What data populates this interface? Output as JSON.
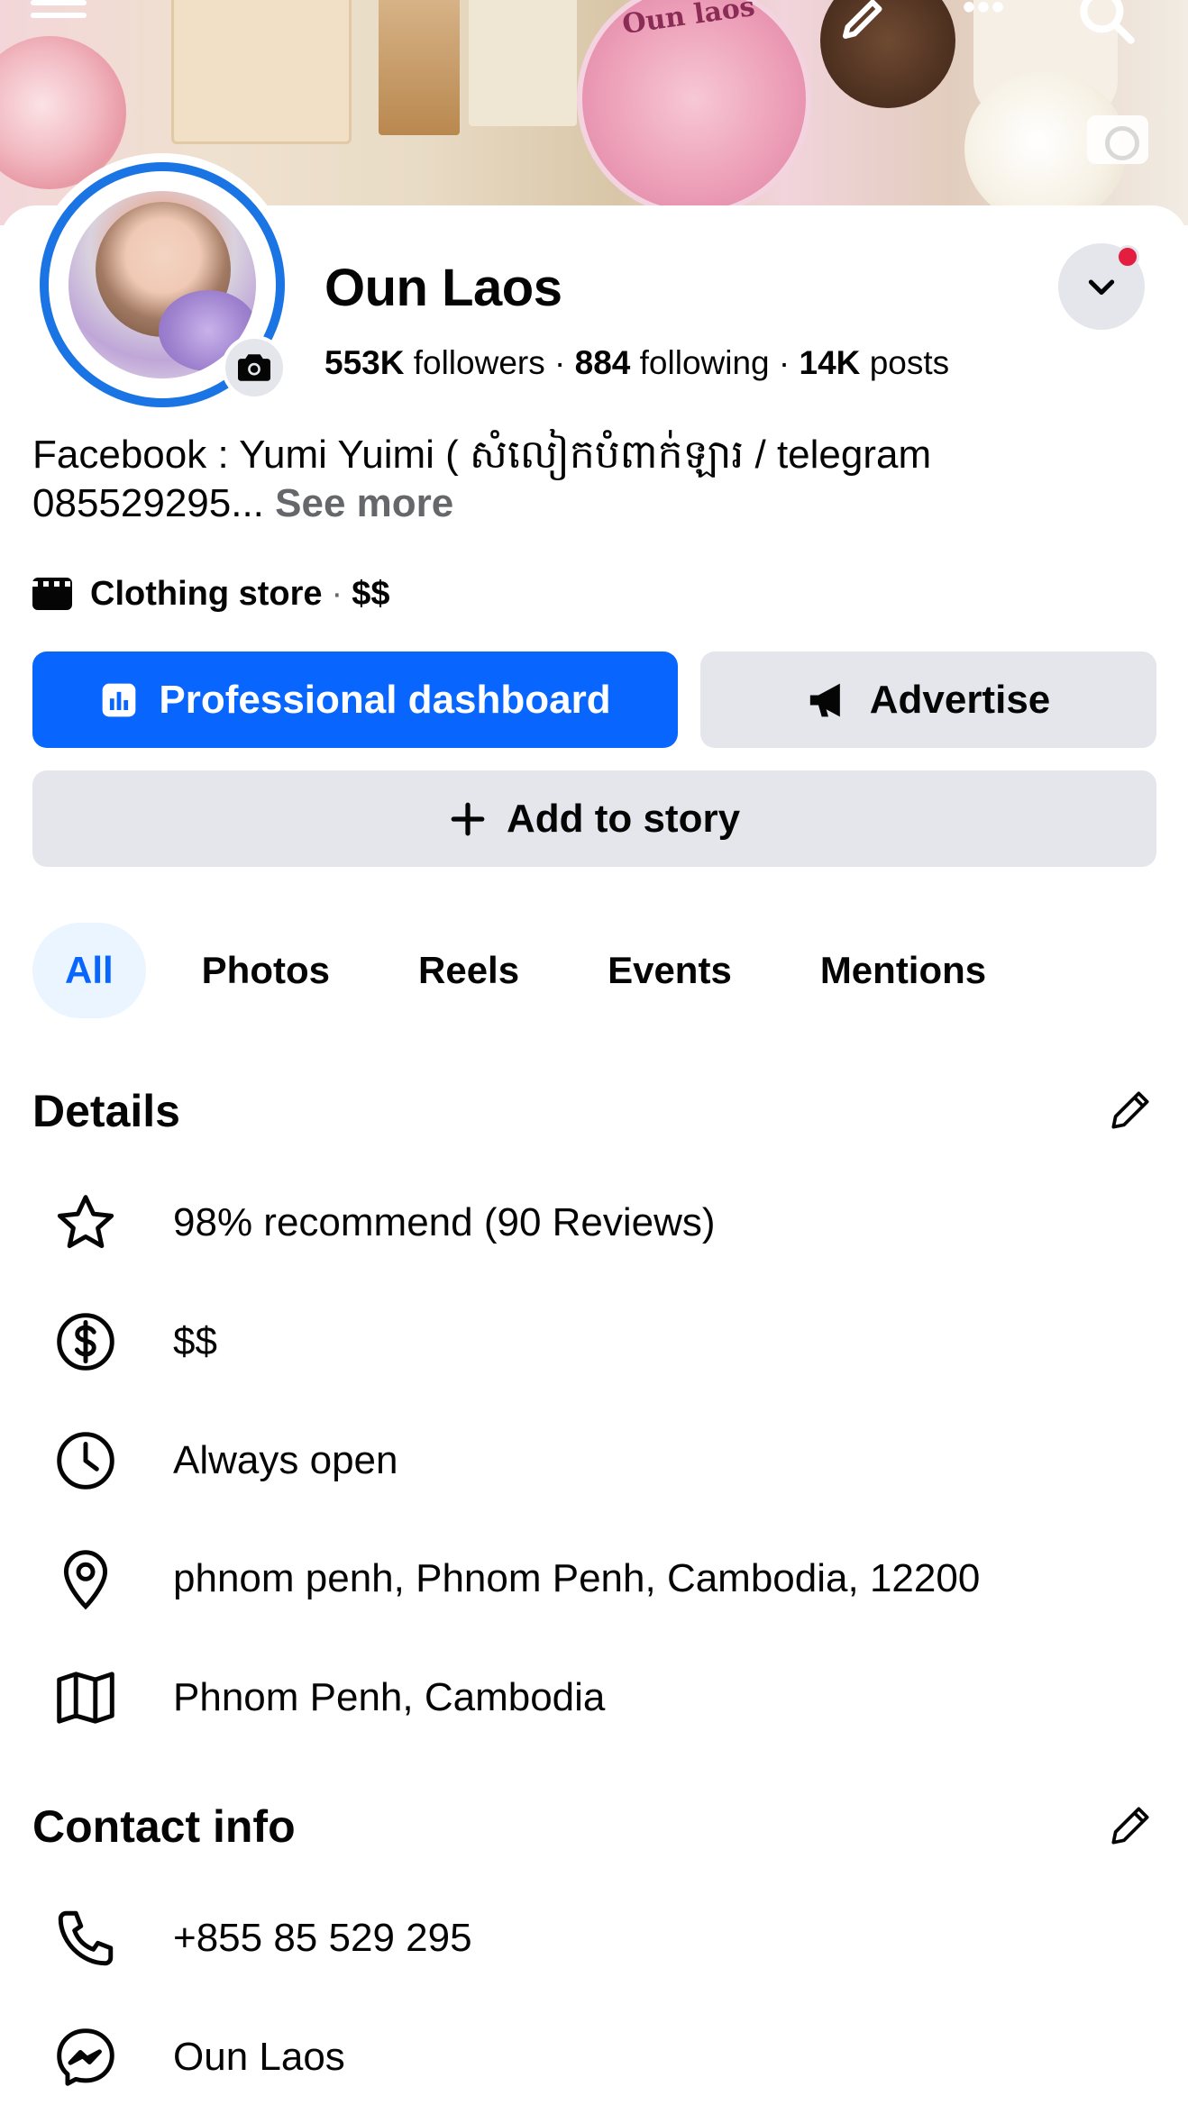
{
  "cover": {
    "jar_text": "Oun laos"
  },
  "profile": {
    "name": "Oun Laos",
    "followers_count": "553K",
    "followers_label": "followers",
    "following_count": "884",
    "following_label": "following",
    "posts_count": "14K",
    "posts_label": "posts",
    "bio": "Facebook : Yumi Yuimi ( សំលៀកបំពាក់ឡារ / telegram 085529295...",
    "see_more": "See more",
    "category": "Clothing store",
    "price": "$$"
  },
  "actions": {
    "dashboard_label": "Professional dashboard",
    "advertise_label": "Advertise",
    "story_label": "Add to story"
  },
  "tabs": [
    {
      "label": "All"
    },
    {
      "label": "Photos"
    },
    {
      "label": "Reels"
    },
    {
      "label": "Events"
    },
    {
      "label": "Mentions"
    }
  ],
  "details": {
    "title": "Details",
    "items": [
      {
        "icon": "star-icon",
        "text": "98% recommend (90 Reviews)"
      },
      {
        "icon": "dollar-icon",
        "text": "$$"
      },
      {
        "icon": "clock-icon",
        "text": "Always open"
      },
      {
        "icon": "location-pin-icon",
        "text": "phnom penh, Phnom Penh, Cambodia, 12200"
      },
      {
        "icon": "map-icon",
        "text": "Phnom Penh, Cambodia"
      }
    ]
  },
  "contact": {
    "title": "Contact info",
    "items": [
      {
        "icon": "phone-icon",
        "text": "+855 85 529 295"
      },
      {
        "icon": "messenger-icon",
        "text": "Oun Laos"
      }
    ]
  },
  "colors": {
    "primary": "#0866ff",
    "avatar_ring": "#1b74e4",
    "secondary_button": "#e4e6eb",
    "active_tab_bg": "#ebf5ff",
    "notification_dot": "#e41e3f"
  }
}
